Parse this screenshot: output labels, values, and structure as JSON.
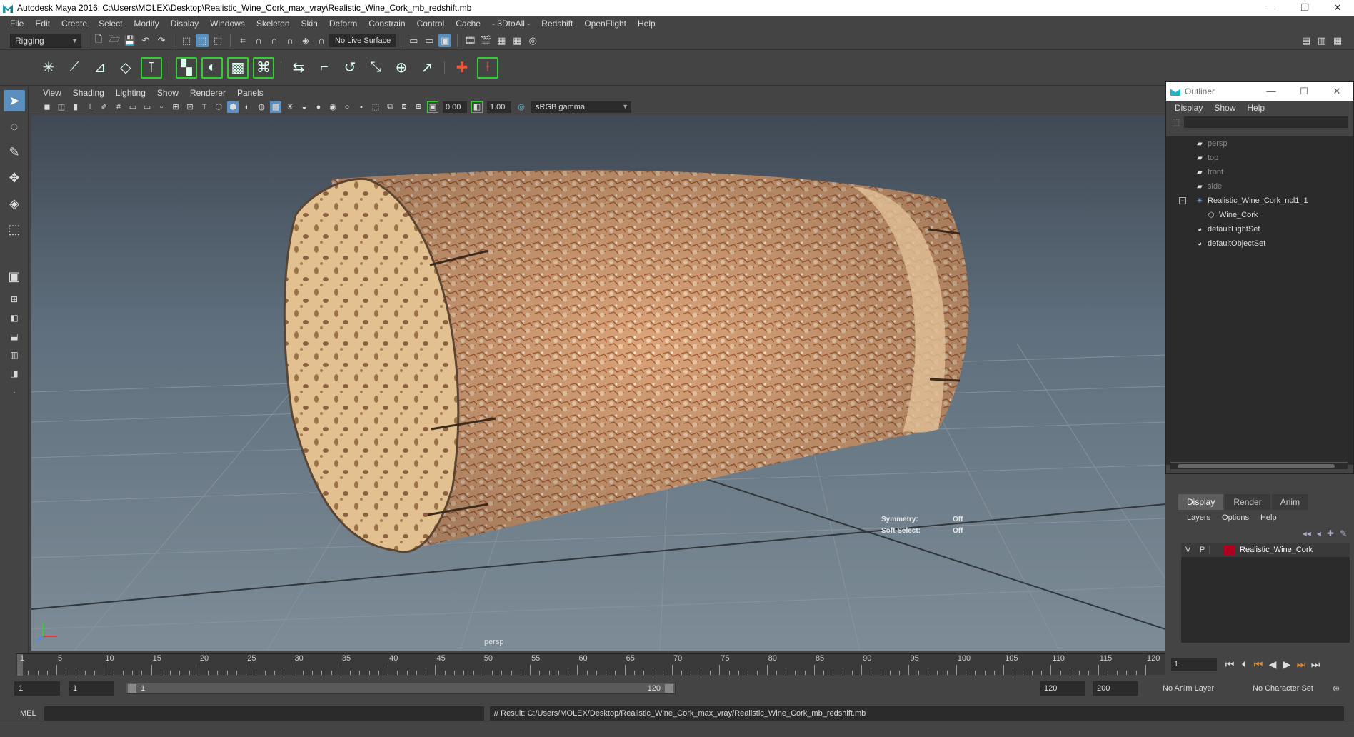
{
  "window": {
    "title": "Autodesk Maya 2016: C:\\Users\\MOLEX\\Desktop\\Realistic_Wine_Cork_max_vray\\Realistic_Wine_Cork_mb_redshift.mb",
    "minimize": "—",
    "restore": "❐",
    "close": "✕"
  },
  "menubar": [
    "File",
    "Edit",
    "Create",
    "Select",
    "Modify",
    "Display",
    "Windows",
    "Skeleton",
    "Skin",
    "Deform",
    "Constrain",
    "Control",
    "Cache",
    "- 3DtoAll -",
    "Redshift",
    "OpenFlight",
    "Help"
  ],
  "statusline": {
    "mode": "Rigging",
    "live_surface": "No Live Surface"
  },
  "viewport": {
    "menus": [
      "View",
      "Shading",
      "Lighting",
      "Show",
      "Renderer",
      "Panels"
    ],
    "exposure": "0.00",
    "gamma": "1.00",
    "color_management": "sRGB gamma",
    "camera_label": "persp",
    "hud": {
      "symmetry_label": "Symmetry:",
      "symmetry_value": "Off",
      "soft_select_label": "Soft Select:",
      "soft_select_value": "Off"
    }
  },
  "outliner": {
    "title": "Outliner",
    "menus": [
      "Display",
      "Show",
      "Help"
    ],
    "items": [
      {
        "label": "persp",
        "icon": "camera-icon",
        "dim": true,
        "indent": 1
      },
      {
        "label": "top",
        "icon": "camera-icon",
        "dim": true,
        "indent": 1
      },
      {
        "label": "front",
        "icon": "camera-icon",
        "dim": true,
        "indent": 1
      },
      {
        "label": "side",
        "icon": "camera-icon",
        "dim": true,
        "indent": 1
      },
      {
        "label": "Realistic_Wine_Cork_ncl1_1",
        "icon": "group-icon",
        "dim": false,
        "indent": 1,
        "expand": "−"
      },
      {
        "label": "Wine_Cork",
        "icon": "mesh-icon",
        "dim": false,
        "indent": 2
      },
      {
        "label": "defaultLightSet",
        "icon": "set-icon",
        "dim": false,
        "indent": 1
      },
      {
        "label": "defaultObjectSet",
        "icon": "set-icon",
        "dim": false,
        "indent": 1
      }
    ]
  },
  "layers": {
    "tabs": [
      "Display",
      "Render",
      "Anim"
    ],
    "menus": [
      "Layers",
      "Options",
      "Help"
    ],
    "rows": [
      {
        "v": "V",
        "p": "P",
        "name": "Realistic_Wine_Cork",
        "color": "#b00020"
      }
    ]
  },
  "timeline": {
    "ticks": [
      "1",
      "5",
      "10",
      "15",
      "20",
      "25",
      "30",
      "35",
      "40",
      "45",
      "50",
      "55",
      "60",
      "65",
      "70",
      "75",
      "80",
      "85",
      "90",
      "95",
      "100",
      "105",
      "110",
      "115",
      "120"
    ],
    "current_frame": "1"
  },
  "range": {
    "start": "1",
    "playback_start": "1",
    "slider_start": "1",
    "slider_end": "120",
    "playback_end": "120",
    "end": "200",
    "anim_layer": "No Anim Layer",
    "character_set": "No Character Set"
  },
  "command": {
    "mel_label": "MEL",
    "result": "// Result: C:/Users/MOLEX/Desktop/Realistic_Wine_Cork_max_vray/Realistic_Wine_Cork_mb_redshift.mb"
  }
}
